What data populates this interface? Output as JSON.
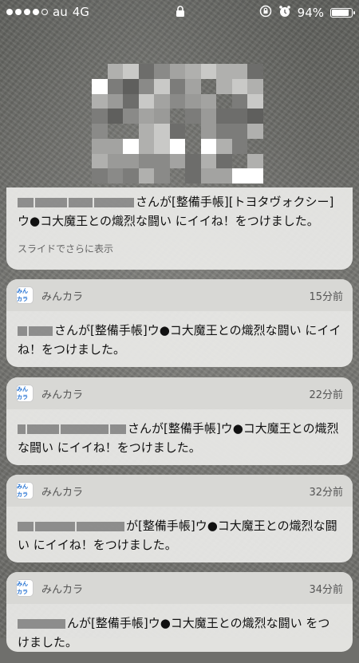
{
  "status_bar": {
    "carrier": "au",
    "network": "4G",
    "battery": "94%",
    "battery_level": 0.94
  },
  "notifications": [
    {
      "body": "さんが[整備手帳][トヨタヴォクシー]ウ●コ大魔王との熾烈な闘い にイイね！をつけました。",
      "more": "スライドでさらに表示"
    },
    {
      "app": "みんカラ",
      "time": "15分前",
      "body": "さんが[整備手帳]ウ●コ大魔王との熾烈な闘い にイイね！をつけました。"
    },
    {
      "app": "みんカラ",
      "time": "22分前",
      "body": "さんが[整備手帳]ウ●コ大魔王との熾烈な闘い にイイね！をつけました。"
    },
    {
      "app": "みんカラ",
      "time": "32分前",
      "body": "が[整備手帳]ウ●コ大魔王との熾烈な闘い にイイね！をつけました。"
    },
    {
      "app": "みんカラ",
      "time": "34分前",
      "body": "んが[整備手帳]ウ●コ大魔王との熾烈な闘い をつけました。"
    }
  ],
  "app_icon_text": "みんカラ"
}
